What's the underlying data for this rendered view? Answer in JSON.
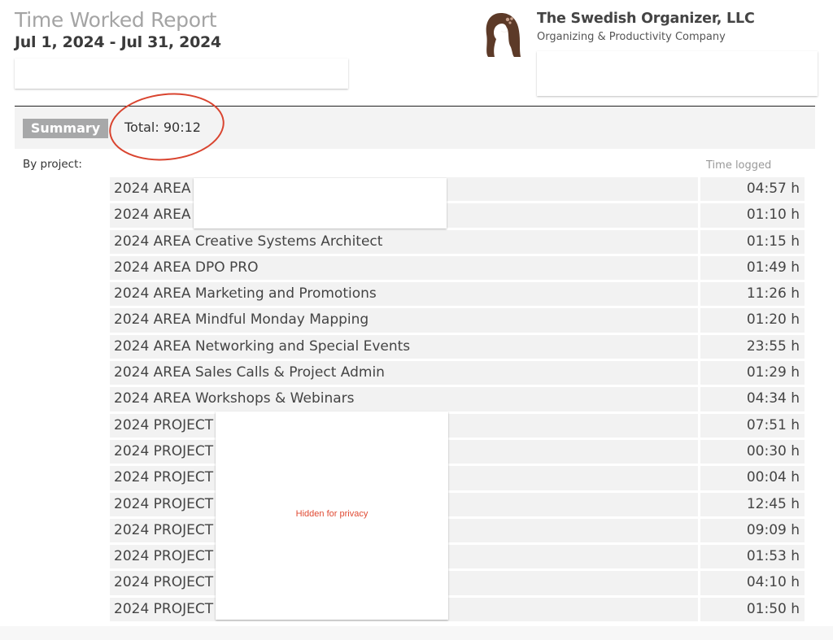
{
  "report": {
    "title": "Time Worked Report",
    "date_range": "Jul 1, 2024 - Jul 31, 2024"
  },
  "company": {
    "name": "The Swedish Organizer, LLC",
    "tagline": "Organizing & Productivity Company",
    "logo_icon": "woman-silhouette-logo-icon"
  },
  "summary": {
    "badge_label": "Summary",
    "total": "Total: 90:12",
    "by_project_label": "By project:",
    "time_logged_header": "Time logged",
    "annotation_color": "#d9442f"
  },
  "rows": [
    {
      "name": "2024 AREA",
      "time": "04:57 h"
    },
    {
      "name": "2024 AREA",
      "time": "01:10 h"
    },
    {
      "name": "2024 AREA Creative Systems Architect",
      "time": "01:15 h"
    },
    {
      "name": "2024 AREA DPO PRO",
      "time": "01:49 h"
    },
    {
      "name": "2024 AREA Marketing and Promotions",
      "time": "11:26 h"
    },
    {
      "name": "2024 AREA Mindful Monday Mapping",
      "time": "01:20 h"
    },
    {
      "name": "2024 AREA Networking and Special Events",
      "time": "23:55 h"
    },
    {
      "name": "2024 AREA Sales Calls & Project Admin",
      "time": "01:29 h"
    },
    {
      "name": "2024 AREA Workshops & Webinars",
      "time": "04:34 h"
    },
    {
      "name": "2024 PROJECT",
      "time": "07:51 h"
    },
    {
      "name": "2024 PROJECT",
      "time": "00:30 h"
    },
    {
      "name": "2024 PROJECT",
      "time": "00:04 h"
    },
    {
      "name": "2024 PROJECT",
      "time": "12:45 h"
    },
    {
      "name": "2024 PROJECT",
      "time": "09:09 h"
    },
    {
      "name": "2024 PROJECT",
      "time": "01:53 h"
    },
    {
      "name": "2024 PROJECT",
      "time": "04:10 h"
    },
    {
      "name": "2024 PROJECT",
      "time": "01:50 h"
    }
  ],
  "redaction": {
    "label": "Hidden for privacy",
    "color": "#e04a33"
  }
}
